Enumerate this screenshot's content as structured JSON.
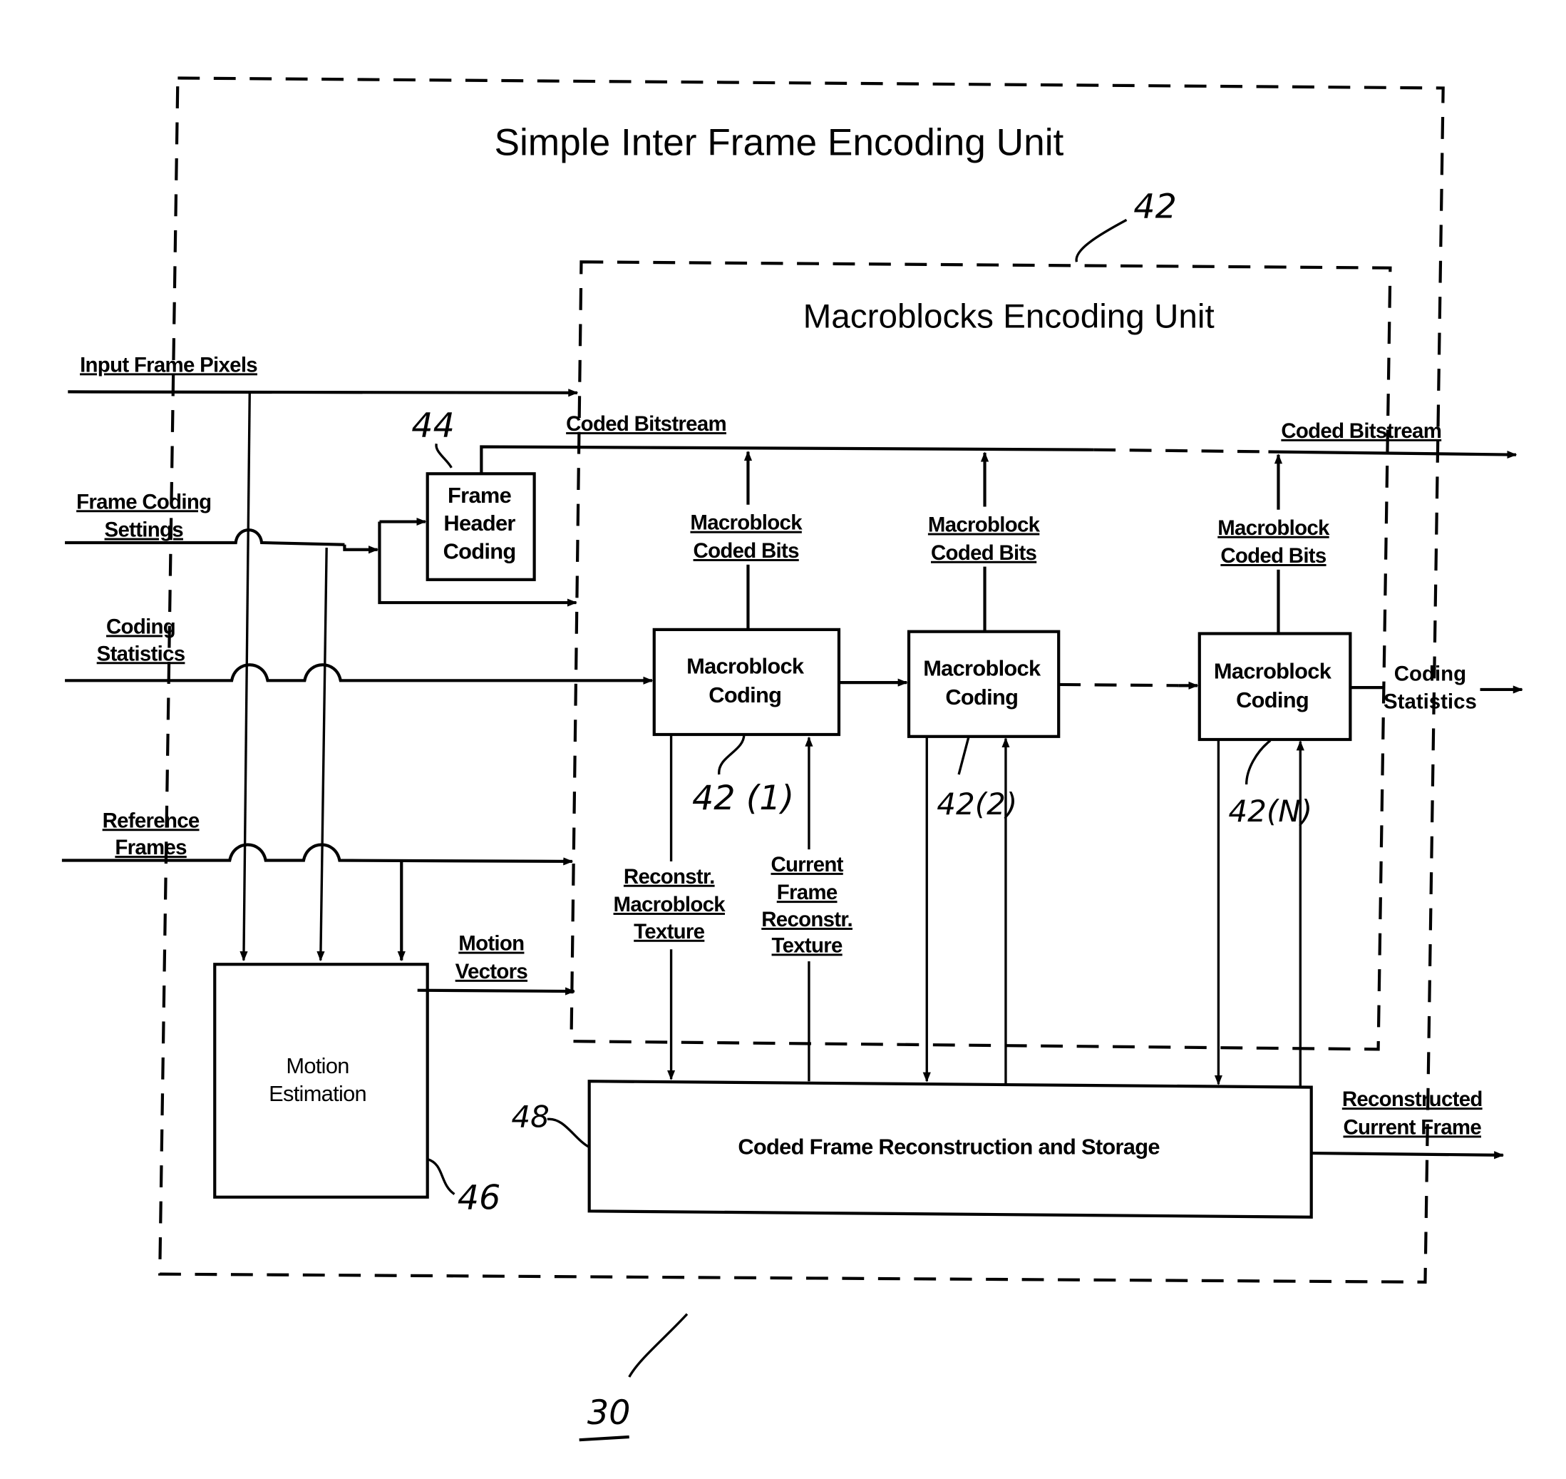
{
  "diagram": {
    "figure_number": "30",
    "outer_unit": {
      "title": "Simple Inter Frame Encoding Unit"
    },
    "inner_unit": {
      "title": "Macroblocks Encoding Unit",
      "ref": "42"
    },
    "inputs": {
      "input_frame_pixels": "Input Frame Pixels",
      "frame_coding_settings": [
        "Frame Coding",
        "Settings"
      ],
      "coding_statistics": [
        "Coding",
        "Statistics"
      ],
      "reference_frames": [
        "Reference",
        "Frames"
      ]
    },
    "blocks": {
      "frame_header": {
        "lines": [
          "Frame",
          "Header",
          "Coding"
        ],
        "ref": "44"
      },
      "mb_coding_1": {
        "lines": [
          "Macroblock",
          "Coding"
        ],
        "ref": "42 (1)"
      },
      "mb_coding_2": {
        "lines": [
          "Macroblock",
          "Coding"
        ],
        "ref": "42(2)"
      },
      "mb_coding_n": {
        "lines": [
          "Macroblock",
          "Coding"
        ],
        "ref": "42(N)"
      },
      "motion_estimation": {
        "lines": [
          "Motion",
          "Estimation"
        ],
        "ref": "46"
      },
      "reconstruction": {
        "label": "Coded Frame Reconstruction and Storage",
        "ref": "48"
      }
    },
    "signals": {
      "coded_bitstream_inner": "Coded Bitstream",
      "coded_bitstream_out": "Coded Bitstream",
      "mb_coded_bits": [
        "Macroblock",
        "Coded Bits"
      ],
      "coding_statistics_out": [
        "Coding",
        "Statistics"
      ],
      "motion_vectors": [
        "Motion",
        "Vectors"
      ],
      "reconstr_mb_texture": [
        "Reconstr.",
        "Macroblock",
        "Texture"
      ],
      "current_frame_reconstr_texture": [
        "Current",
        "Frame",
        "Reconstr.",
        "Texture"
      ],
      "reconstructed_current_frame": [
        "Reconstructed",
        "Current Frame"
      ]
    }
  }
}
